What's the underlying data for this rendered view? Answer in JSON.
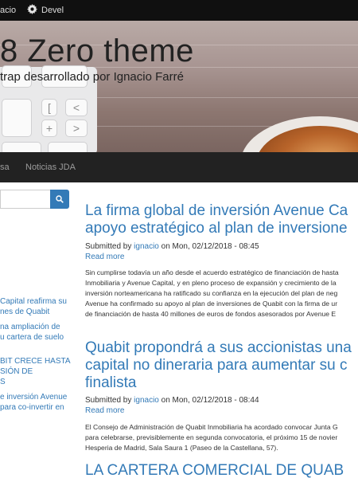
{
  "toolbar": {
    "user_label": "acio",
    "devel_label": "Devel"
  },
  "header": {
    "site_name": "8 Zero theme",
    "slogan": "trap desarrollado por Ignacio Farré",
    "keyboard_keys": [
      "[",
      "<",
      "+",
      ">"
    ]
  },
  "nav": {
    "items": [
      "sa",
      "Noticias JDA"
    ]
  },
  "sidebar": {
    "links": [
      [
        "Capital reafirma su",
        "nes de Quabit"
      ],
      [
        "na ampliación de",
        "u cartera de suelo"
      ],
      [
        "BIT CRECE HASTA",
        "SIÓN DE",
        "S"
      ],
      [
        "e inversión Avenue",
        "para co-invertir en"
      ]
    ]
  },
  "articles": [
    {
      "title_lines": [
        "La firma global de inversión Avenue Ca",
        "apoyo estratégico al plan de inversione"
      ],
      "submitted_prefix": "Submitted by ",
      "author": "ignacio",
      "submitted_suffix": " on Mon, 02/12/2018 - 08:45",
      "read_more": "Read more",
      "body_lines": [
        "Sin cumplirse todavía un año desde el acuerdo estratégico de financiación de hasta",
        "Inmobiliaria y Avenue Capital, y en pleno proceso de expansión y crecimiento de la",
        "inversión norteamericana ha ratificado su confianza en la ejecución del plan de neg",
        "Avenue ha confirmado su apoyo al plan de inversiones de Quabit con la firma de ur",
        "de financiación de hasta 40 millones de euros de fondos asesorados por Avenue E"
      ]
    },
    {
      "title_lines": [
        "Quabit propondrá a sus accionistas una",
        "capital no dineraria para aumentar su c",
        "finalista"
      ],
      "submitted_prefix": "Submitted by ",
      "author": "ignacio",
      "submitted_suffix": " on Mon, 02/12/2018 - 08:44",
      "read_more": "Read more",
      "body_lines": [
        "El Consejo de Administración de Quabit Inmobiliaria ha acordado convocar Junta G",
        "para celebrarse, previsiblemente en segunda convocatoria, el próximo 15 de novier",
        "Hesperia de Madrid, Sala Saura 1 (Paseo de la Castellana, 57)."
      ]
    },
    {
      "title_lines": [
        "LA CARTERA COMERCIAL DE QUAB"
      ]
    }
  ],
  "colors": {
    "link": "#337ab7",
    "toolbar_bg": "#101010",
    "nav_bg": "#222222"
  },
  "icons": {
    "toolbar_devel": "gear-icon",
    "search_button": "search-icon"
  }
}
